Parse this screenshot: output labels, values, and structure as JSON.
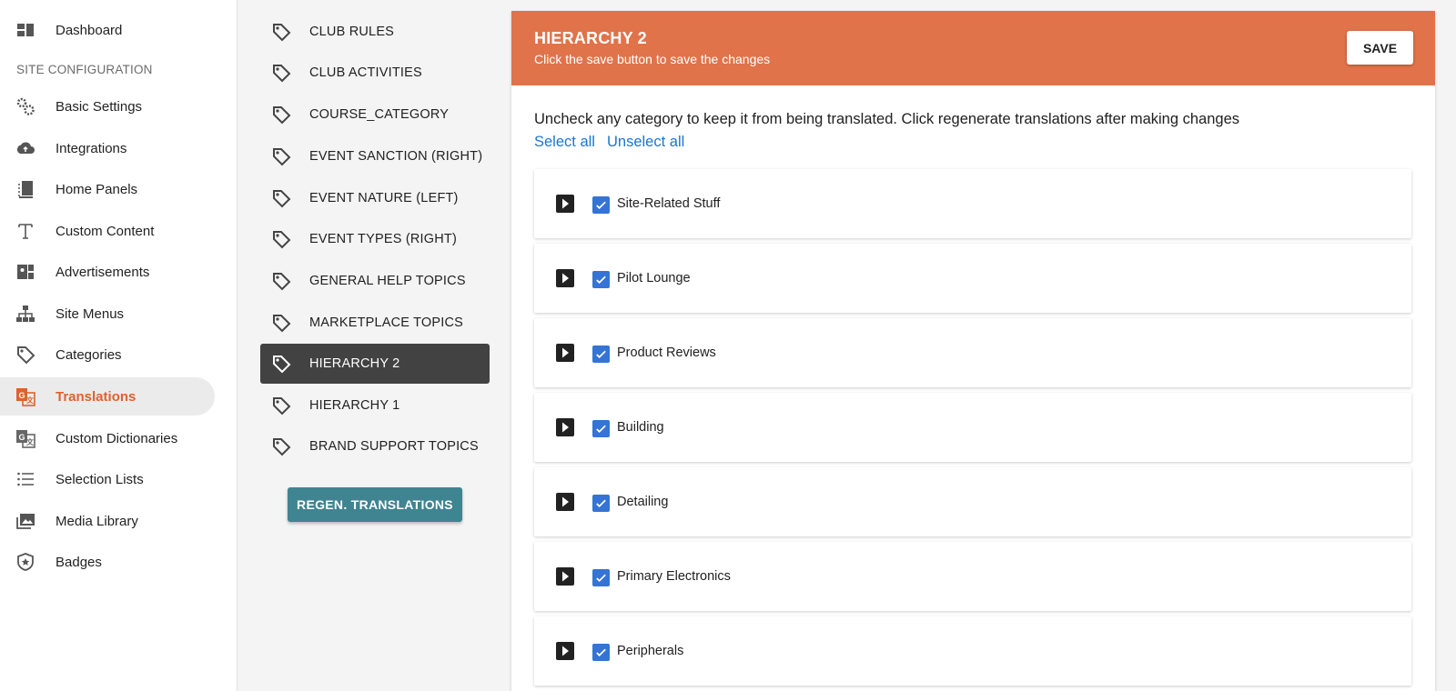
{
  "nav": {
    "section_label": "SITE CONFIGURATION",
    "items": [
      {
        "label": "Dashboard",
        "icon": "dashboard-icon"
      },
      {
        "label": "Basic Settings",
        "icon": "gears-icon"
      },
      {
        "label": "Integrations",
        "icon": "cloud-sync-icon"
      },
      {
        "label": "Home Panels",
        "icon": "panels-icon"
      },
      {
        "label": "Custom Content",
        "icon": "text-icon"
      },
      {
        "label": "Advertisements",
        "icon": "ad-icon"
      },
      {
        "label": "Site Menus",
        "icon": "sitemap-icon"
      },
      {
        "label": "Categories",
        "icon": "tag-icon"
      },
      {
        "label": "Translations",
        "icon": "translate-icon",
        "active": true
      },
      {
        "label": "Custom Dictionaries",
        "icon": "dictionary-icon"
      },
      {
        "label": "Selection Lists",
        "icon": "list-icon"
      },
      {
        "label": "Media Library",
        "icon": "images-icon"
      },
      {
        "label": "Badges",
        "icon": "badge-icon"
      }
    ]
  },
  "categories": {
    "items": [
      {
        "label": "CLUB RULES"
      },
      {
        "label": "CLUB ACTIVITIES"
      },
      {
        "label": "COURSE_CATEGORY"
      },
      {
        "label": "EVENT SANCTION (RIGHT)"
      },
      {
        "label": "EVENT NATURE (LEFT)"
      },
      {
        "label": "EVENT TYPES (RIGHT)"
      },
      {
        "label": "GENERAL HELP TOPICS"
      },
      {
        "label": "MARKETPLACE TOPICS"
      },
      {
        "label": "HIERARCHY 2",
        "active": true
      },
      {
        "label": "HIERARCHY 1"
      },
      {
        "label": "BRAND SUPPORT TOPICS"
      }
    ],
    "regen_label": "REGEN. TRANSLATIONS"
  },
  "panel": {
    "title": "HIERARCHY 2",
    "subtitle": "Click the save button to save the changes",
    "save_label": "SAVE",
    "instructions": "Uncheck any category to keep it from being translated. Click regenerate translations after making changes",
    "select_all": "Select all",
    "unselect_all": "Unselect all",
    "rows": [
      {
        "label": "Site-Related Stuff",
        "checked": true
      },
      {
        "label": "Pilot Lounge",
        "checked": true
      },
      {
        "label": "Product Reviews",
        "checked": true
      },
      {
        "label": "Building",
        "checked": true
      },
      {
        "label": "Detailing",
        "checked": true
      },
      {
        "label": "Primary Electronics",
        "checked": true
      },
      {
        "label": "Peripherals",
        "checked": true
      }
    ]
  },
  "colors": {
    "accent": "#e0734a",
    "active_nav_text": "#e0612f",
    "regen_button": "#3f8491",
    "checkbox": "#3574d4",
    "link": "#1976d2"
  }
}
